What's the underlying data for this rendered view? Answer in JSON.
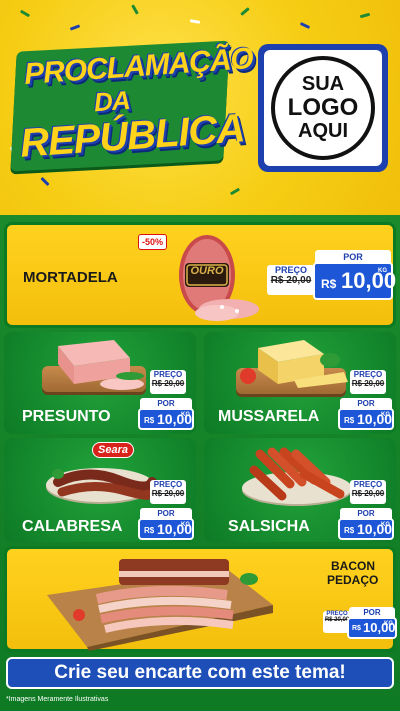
{
  "header": {
    "title_line1": "PROCLAMAÇÃO",
    "title_line2": "DA",
    "title_line3": "REPÚBLICA",
    "logo_line1": "SUA",
    "logo_line2": "LOGO",
    "logo_line3": "AQUI"
  },
  "products": [
    {
      "name": "MORTADELA",
      "badge": "-50%",
      "brand": "OURO",
      "price_label": "PREÇO",
      "old_price": "R$ 20,00",
      "por_label": "POR",
      "currency": "R$",
      "new_price": "10,00",
      "unit": "KG"
    },
    {
      "name": "PRESUNTO",
      "price_label": "PREÇO",
      "old_price": "R$ 20,00",
      "por_label": "POR",
      "currency": "R$",
      "new_price": "10,00",
      "unit": "KG"
    },
    {
      "name": "MUSSARELA",
      "price_label": "PREÇO",
      "old_price": "R$ 20,00",
      "por_label": "POR",
      "currency": "R$",
      "new_price": "10,00",
      "unit": "KG"
    },
    {
      "name": "CALABRESA",
      "brand": "Seara",
      "price_label": "PREÇO",
      "old_price": "R$ 20,00",
      "por_label": "POR",
      "currency": "R$",
      "new_price": "10,00",
      "unit": "KG"
    },
    {
      "name": "SALSICHA",
      "price_label": "PREÇO",
      "old_price": "R$ 20,00",
      "por_label": "POR",
      "currency": "R$",
      "new_price": "10,00",
      "unit": "KG"
    },
    {
      "name_line1": "BACON",
      "name_line2": "PEDAÇO",
      "price_label": "PREÇO",
      "old_price": "R$ 20,00",
      "por_label": "POR",
      "currency": "R$",
      "new_price": "10,00",
      "unit": "KG"
    }
  ],
  "footer": {
    "cta": "Crie seu encarte com este tema!",
    "note": "*Imagens Meramente Ilustrativas"
  },
  "colors": {
    "yellow": "#f6cd14",
    "green": "#0f7a24",
    "blue": "#1e56d8"
  }
}
